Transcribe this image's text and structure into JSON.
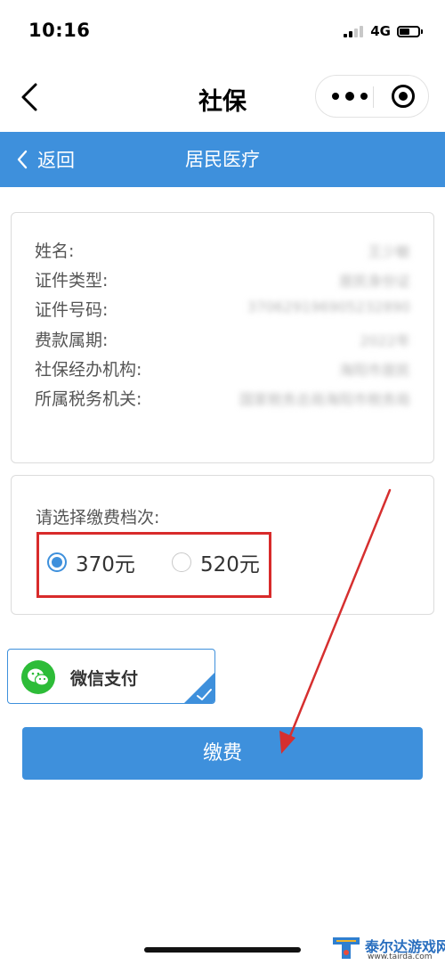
{
  "status_bar": {
    "time": "10:16",
    "network": "4G",
    "signal_icon": "signal-bars-icon",
    "battery_icon": "battery-icon"
  },
  "nav_bar": {
    "title": "社保",
    "back_icon": "chevron-left-icon",
    "more_icon": "more-dots-icon",
    "close_icon": "target-circle-icon"
  },
  "header": {
    "back_label": "返回",
    "title": "居民医疗",
    "background_color": "#3e90dc"
  },
  "info": {
    "rows": [
      {
        "label": "姓名:",
        "value": "王少敏"
      },
      {
        "label": "证件类型:",
        "value": "居民身份证"
      },
      {
        "label": "证件号码:",
        "value": "370629196905232890"
      },
      {
        "label": "费款属期:",
        "value": "2022年"
      },
      {
        "label": "社保经办机构:",
        "value": "海阳市居民"
      },
      {
        "label": "所属税务机关:",
        "value": "国家税务总局海阳市税务局"
      }
    ]
  },
  "tier": {
    "label": "请选择缴费档次:",
    "options": [
      {
        "label": "370元",
        "selected": true
      },
      {
        "label": "520元",
        "selected": false
      }
    ],
    "highlight_color": "#d82b2b"
  },
  "payment": {
    "method_label": "微信支付",
    "method_icon": "wechat-icon",
    "selected": true
  },
  "pay_button": {
    "label": "缴费"
  },
  "watermark": {
    "name": "泰尔达游戏网",
    "url": "www.tairda.com"
  }
}
